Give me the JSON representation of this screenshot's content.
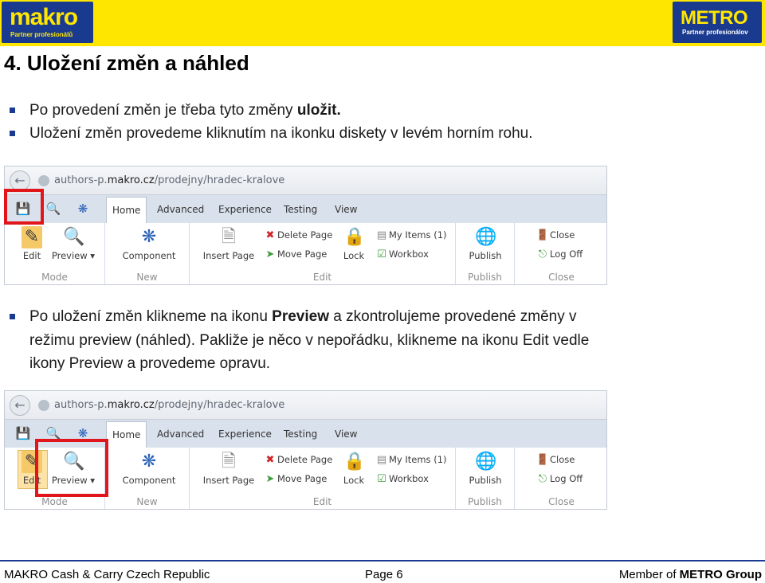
{
  "header": {
    "makro_logo": "makro",
    "makro_tagline": "Partner profesionálů",
    "metro_logo": "METRO",
    "metro_tagline": "Partner profesionálov",
    "brand_yellow": "#ffe600",
    "brand_blue": "#1a3a8f"
  },
  "title": "4. Uložení změn a náhled",
  "bullets_top": [
    {
      "text": "Po provedení změn je třeba tyto změny ",
      "bold": "uložit."
    },
    {
      "text": "Uložení změn provedeme kliknutím na ikonku diskety v levém horním rohu."
    }
  ],
  "bullet_bottom": {
    "line1_pre": "Po uložení změn klikneme na ikonu ",
    "line1_bold": "Preview",
    "line1_post": " a zkontrolujeme provedené změny v",
    "line2": "režimu preview (náhled). Pakliže je něco v nepořádku, klikneme na ikonu Edit vedle",
    "line3": "ikony Preview a provedeme opravu."
  },
  "screenshot": {
    "url_prefix": "authors-p.",
    "url_domain": "makro.cz",
    "url_path": "/prodejny/hradec-kralove",
    "tabs": [
      "Home",
      "Advanced",
      "Experience",
      "Testing",
      "View"
    ],
    "active_tab": "Home",
    "groups": {
      "mode": "Mode",
      "new": "New",
      "edit": "Edit",
      "publish": "Publish",
      "close": "Close"
    },
    "buttons": {
      "edit": "Edit",
      "preview": "Preview",
      "component": "Component",
      "insert_page": "Insert Page",
      "delete_page": "Delete Page",
      "move_page": "Move Page",
      "lock": "Lock",
      "my_items": "My Items (1)",
      "workbox": "Workbox",
      "publish": "Publish",
      "close": "Close",
      "log_off": "Log Off"
    },
    "highlight_color": "#e1151c"
  },
  "footer": {
    "left": "MAKRO Cash & Carry Czech Republic",
    "center": "Page 6",
    "right_pre": "Member of ",
    "right_bold": "METRO Group"
  }
}
